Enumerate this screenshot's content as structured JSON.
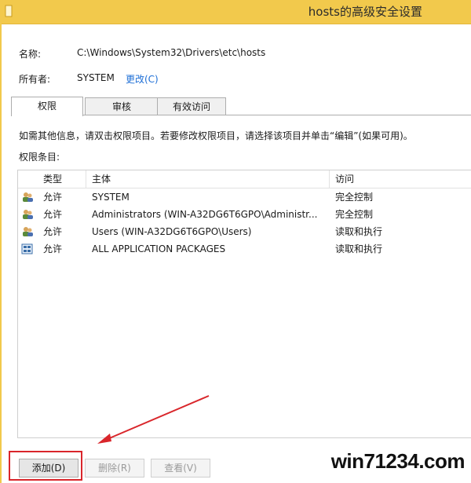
{
  "window": {
    "title": "hosts的高级安全设置"
  },
  "info": {
    "name_label": "名称:",
    "name_value": "C:\\Windows\\System32\\Drivers\\etc\\hosts",
    "owner_label": "所有者:",
    "owner_value": "SYSTEM",
    "change_link": "更改(C)"
  },
  "tabs": [
    {
      "label": "权限",
      "active": true
    },
    {
      "label": "审核",
      "active": false
    },
    {
      "label": "有效访问",
      "active": false
    }
  ],
  "hint_text": "如需其他信息，请双击权限项目。若要修改权限项目，请选择该项目并单击“编辑”(如果可用)。",
  "entries_label": "权限条目:",
  "table": {
    "columns": [
      "类型",
      "主体",
      "访问"
    ],
    "rows": [
      {
        "icon": "users-icon",
        "type": "允许",
        "principal": "SYSTEM",
        "access": "完全控制"
      },
      {
        "icon": "users-icon",
        "type": "允许",
        "principal": "Administrators (WIN-A32DG6T6GPO\\Administr...",
        "access": "完全控制"
      },
      {
        "icon": "users-icon",
        "type": "允许",
        "principal": "Users (WIN-A32DG6T6GPO\\Users)",
        "access": "读取和执行"
      },
      {
        "icon": "app-packages-icon",
        "type": "允许",
        "principal": "ALL APPLICATION PACKAGES",
        "access": "读取和执行"
      }
    ]
  },
  "buttons": {
    "add": "添加(D)",
    "remove": "删除(R)",
    "view": "查看(V)"
  },
  "watermark": "win71234.com",
  "colors": {
    "titlebar": "#f2c94c",
    "link": "#1e6fd6",
    "highlight": "#d9262b"
  }
}
